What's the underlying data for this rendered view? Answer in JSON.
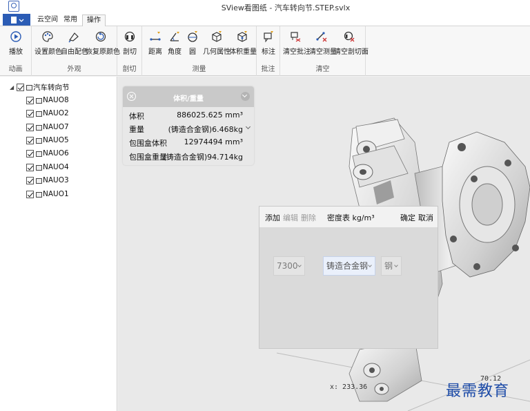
{
  "window": {
    "title": "SView看图纸 - 汽车转向节.STEP.svlx"
  },
  "tabs": [
    {
      "label": "云空间"
    },
    {
      "label": "常用"
    },
    {
      "label": "操作",
      "active": true
    }
  ],
  "ribbon": {
    "groups": [
      {
        "label": "动画",
        "buttons": [
          {
            "label": "播放",
            "icon": "play-icon"
          }
        ]
      },
      {
        "label": "外观",
        "buttons": [
          {
            "label": "设置颜色",
            "icon": "palette-icon"
          },
          {
            "label": "自由配色",
            "icon": "paint-icon"
          },
          {
            "label": "恢复原颜色",
            "icon": "restore-color-icon"
          }
        ]
      },
      {
        "label": "剖切",
        "buttons": [
          {
            "label": "剖切",
            "icon": "section-icon"
          }
        ]
      },
      {
        "label": "测量",
        "buttons": [
          {
            "label": "距离",
            "icon": "distance-icon"
          },
          {
            "label": "角度",
            "icon": "angle-icon"
          },
          {
            "label": "圆",
            "icon": "circle-icon"
          },
          {
            "label": "几何属性",
            "icon": "geometry-icon"
          },
          {
            "label": "体积重量",
            "icon": "volume-icon"
          }
        ]
      },
      {
        "label": "批注",
        "buttons": [
          {
            "label": "标注",
            "icon": "annotate-icon"
          }
        ]
      },
      {
        "label": "清空",
        "buttons": [
          {
            "label": "清空批注",
            "icon": "clear-annotation-icon"
          },
          {
            "label": "清空测量",
            "icon": "clear-measure-icon"
          },
          {
            "label": "清空剖切面",
            "icon": "clear-section-icon"
          }
        ]
      }
    ]
  },
  "tree": {
    "root": "汽车转向节",
    "items": [
      "NAUO8",
      "NAUO2",
      "NAUO7",
      "NAUO5",
      "NAUO6",
      "NAUO4",
      "NAUO3",
      "NAUO1"
    ]
  },
  "info_panel": {
    "title": "体积/重量",
    "rows": [
      {
        "key": "体积",
        "value": "886025.625 mm³"
      },
      {
        "key": "重量",
        "value": "(铸造合金钢)6.468kg"
      },
      {
        "key": "包围盒体积",
        "value": "12974494 mm³"
      },
      {
        "key": "包围盒重量",
        "value": "(铸造合金钢)94.714kg"
      }
    ]
  },
  "density_dialog": {
    "add": "添加",
    "edit": "编辑",
    "delete": "删除",
    "title": "密度表 kg/m³",
    "ok": "确定",
    "cancel": "取消",
    "density_value": "7300",
    "material": "铸造合金钢",
    "category": "钢"
  },
  "viewport": {
    "coord": "x: 233.36",
    "label_partial": "70.12"
  },
  "watermark": "最需教育",
  "colors": {
    "accent": "#2b5cb5",
    "ribbon": "#f7f7f7",
    "watermark": "#1e4ca8"
  }
}
